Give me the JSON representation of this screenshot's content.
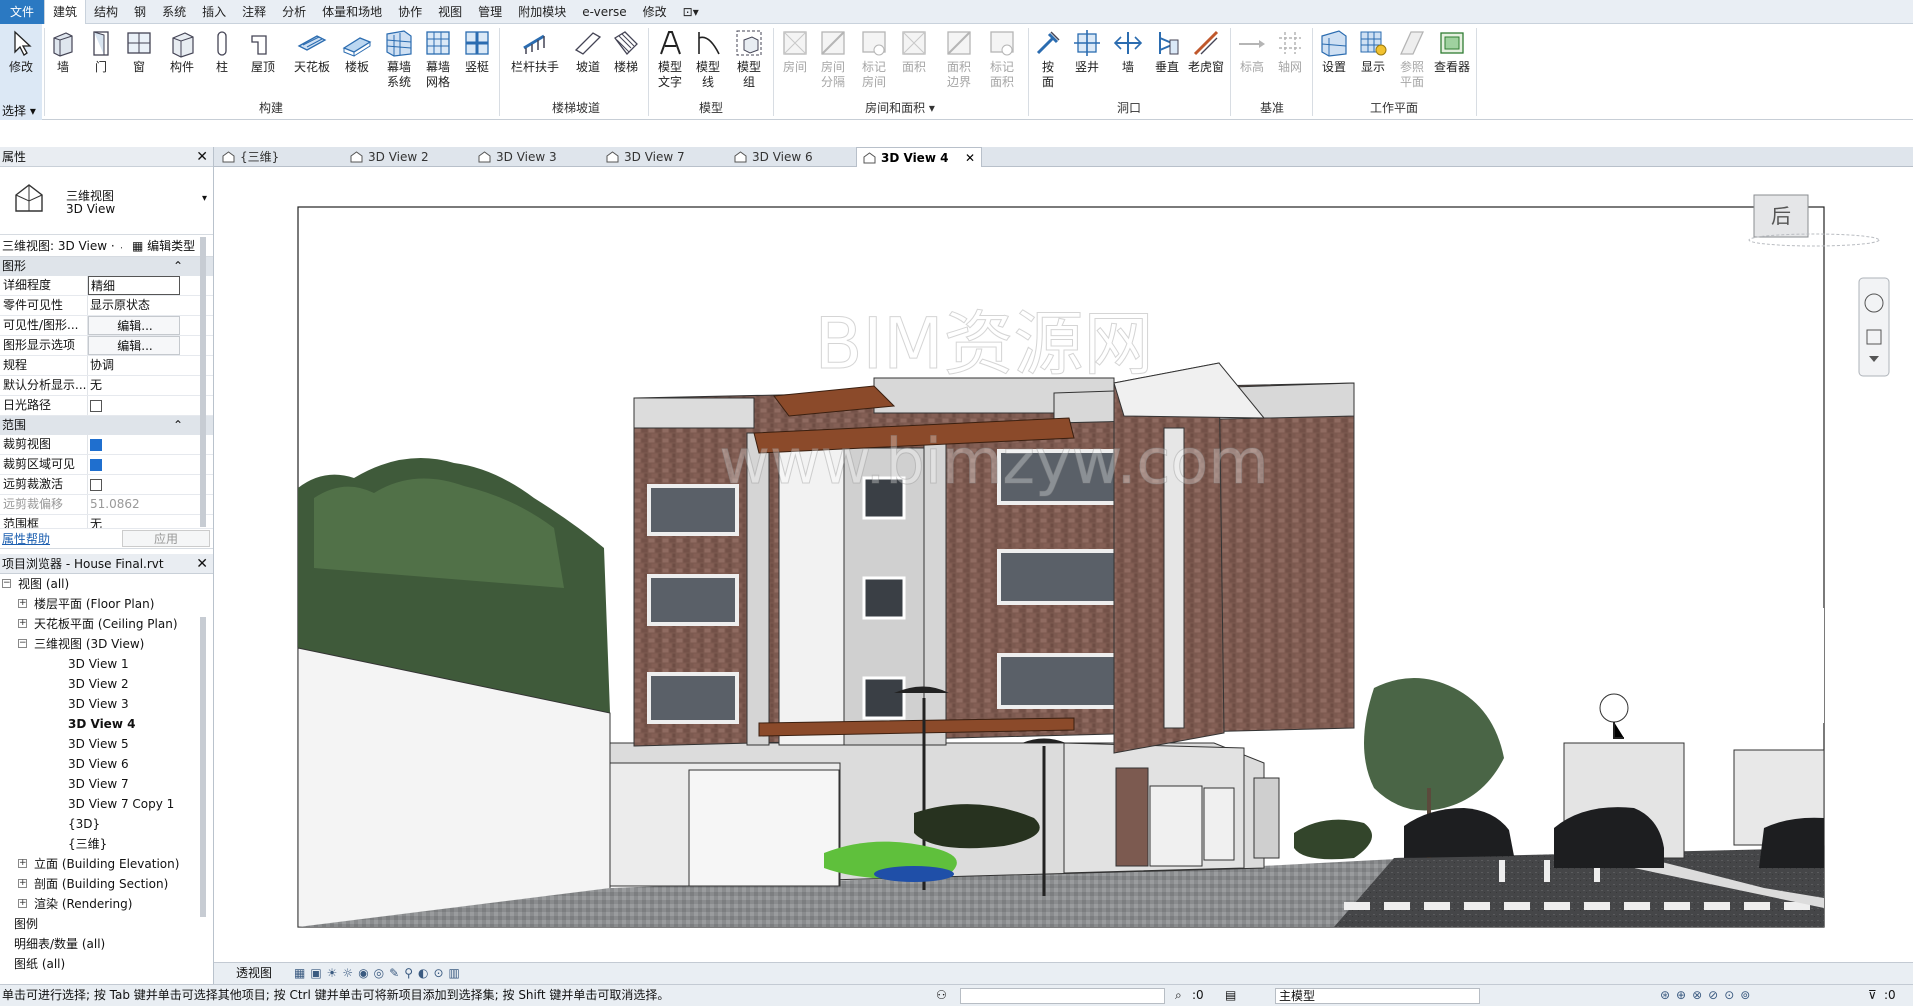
{
  "menu": {
    "file": "文件",
    "tabs": [
      "建筑",
      "结构",
      "钢",
      "系统",
      "插入",
      "注释",
      "分析",
      "体量和场地",
      "协作",
      "视图",
      "管理",
      "附加模块",
      "e-verse",
      "修改"
    ],
    "extra": "⊡▾"
  },
  "ribbon": {
    "select": {
      "modify": "修改",
      "select": "选择",
      "arrow": "▾"
    },
    "build": [
      "墙",
      "门",
      "窗",
      "构件",
      "柱",
      "屋顶",
      "天花板",
      "楼板",
      "幕墙\n系统",
      "幕墙\n网格",
      "竖梃"
    ],
    "circulation": [
      "栏杆扶手",
      "坡道",
      "楼梯"
    ],
    "model": [
      "模型\n文字",
      "模型\n线",
      "模型\n组"
    ],
    "room": [
      "房间",
      "房间\n分隔",
      "标记\n房间",
      "面积",
      "面积\n边界",
      "标记\n面积"
    ],
    "opening": [
      "按\n面",
      "竖井",
      "墙",
      "垂直",
      "老虎窗"
    ],
    "datum": [
      "标高",
      "轴网"
    ],
    "workplane": [
      "设置",
      "显示",
      "参照\n平面",
      "查看器"
    ],
    "groups": {
      "build": "构建",
      "circulation": "楼梯坡道",
      "model": "模型",
      "room": "房间和面积",
      "room_arrow": "▾",
      "opening": "洞口",
      "datum": "基准",
      "workplane": "工作平面"
    }
  },
  "properties": {
    "title": "属性",
    "type_name": "三维视图",
    "type_sub": "3D View",
    "selector": "三维视图: 3D View ·",
    "edit_type": "编辑类型",
    "sections": {
      "graphics": "图形",
      "extents": "范围"
    },
    "rows": [
      {
        "k": "详细程度",
        "v": "精细"
      },
      {
        "k": "零件可见性",
        "v": "显示原状态"
      },
      {
        "k": "可见性/图形...",
        "v": "编辑..."
      },
      {
        "k": "图形显示选项",
        "v": "编辑..."
      },
      {
        "k": "规程",
        "v": "协调"
      },
      {
        "k": "默认分析显示...",
        "v": "无"
      },
      {
        "k": "日光路径",
        "v": ""
      }
    ],
    "rows2": [
      {
        "k": "裁剪视图",
        "v": ""
      },
      {
        "k": "裁剪区域可见",
        "v": ""
      },
      {
        "k": "远剪裁激活",
        "v": ""
      },
      {
        "k": "远剪裁偏移",
        "v": "51.0862"
      },
      {
        "k": "范围框",
        "v": "无"
      }
    ],
    "help": "属性帮助",
    "apply": "应用"
  },
  "browser": {
    "title": "项目浏览器 - House Final.rvt",
    "items": [
      {
        "label": "视图 (all)",
        "level": 0,
        "tw": "⊟"
      },
      {
        "label": "楼层平面 (Floor Plan)",
        "level": 1,
        "tw": "⊞"
      },
      {
        "label": "天花板平面 (Ceiling Plan)",
        "level": 1,
        "tw": "⊞"
      },
      {
        "label": "三维视图 (3D View)",
        "level": 1,
        "tw": "⊟"
      },
      {
        "label": "3D View 1",
        "level": 2
      },
      {
        "label": "3D View 2",
        "level": 2
      },
      {
        "label": "3D View 3",
        "level": 2
      },
      {
        "label": "3D View 4",
        "level": 2,
        "bold": true
      },
      {
        "label": "3D View 5",
        "level": 2
      },
      {
        "label": "3D View 6",
        "level": 2
      },
      {
        "label": "3D View 7",
        "level": 2
      },
      {
        "label": "3D View 7 Copy 1",
        "level": 2
      },
      {
        "label": "{3D}",
        "level": 2
      },
      {
        "label": "{三维}",
        "level": 2
      },
      {
        "label": "立面 (Building Elevation)",
        "level": 1,
        "tw": "⊞"
      },
      {
        "label": "剖面 (Building Section)",
        "level": 1,
        "tw": "⊞"
      },
      {
        "label": "渲染 (Rendering)",
        "level": 1,
        "tw": "⊞"
      },
      {
        "label": "图例",
        "level": 0
      },
      {
        "label": "明细表/数量 (all)",
        "level": 0
      },
      {
        "label": "图纸 (all)",
        "level": 0
      }
    ]
  },
  "tabs": [
    {
      "label": "{三维}"
    },
    {
      "label": "3D View 2"
    },
    {
      "label": "3D View 3"
    },
    {
      "label": "3D View 7"
    },
    {
      "label": "3D View 6"
    },
    {
      "label": "3D View 4",
      "active": true,
      "close": "✕"
    }
  ],
  "viewcube": {
    "face": "后"
  },
  "watermark": {
    "line1": "BIM资源网",
    "line2": "www.bimzyw.com"
  },
  "viewbar": {
    "mode": "透视图"
  },
  "status": {
    "hint": "单击可进行选择; 按 Tab 键并单击可选择其他项目; 按 Ctrl 键并单击可将新项目添加到选择集; 按 Shift 键并单击可取消选择。",
    "zero1": ":0",
    "model": "主模型",
    "zero2": ":0"
  }
}
